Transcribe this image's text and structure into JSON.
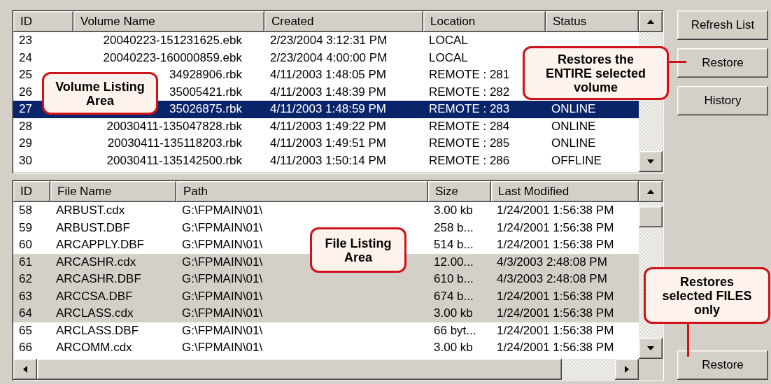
{
  "volumes": {
    "columns": [
      "ID",
      "Volume Name",
      "Created",
      "Location",
      "Status"
    ],
    "rows": [
      {
        "id": "23",
        "name": "20040223-151231625.ebk",
        "created": "2/23/2004 3:12:31 PM",
        "location": "LOCAL",
        "selected": false
      },
      {
        "id": "24",
        "name": "20040223-160000859.ebk",
        "created": "2/23/2004 4:00:00 PM",
        "location": "LOCAL",
        "selected": false
      },
      {
        "id": "25",
        "name": "34928906.rbk",
        "created": "4/11/2003 1:48:05 PM",
        "location": "REMOTE : 281",
        "selected": false
      },
      {
        "id": "26",
        "name": "35005421.rbk",
        "created": "4/11/2003 1:48:39 PM",
        "location": "REMOTE : 282",
        "selected": false
      },
      {
        "id": "27",
        "name": "35026875.rbk",
        "created": "4/11/2003 1:48:59 PM",
        "location": "REMOTE : 283",
        "status": "ONLINE",
        "selected": true
      },
      {
        "id": "28",
        "name": "20030411-135047828.rbk",
        "created": "4/11/2003 1:49:22 PM",
        "location": "REMOTE : 284",
        "status": "ONLINE",
        "selected": false
      },
      {
        "id": "29",
        "name": "20030411-135118203.rbk",
        "created": "4/11/2003 1:49:51 PM",
        "location": "REMOTE : 285",
        "status": "ONLINE",
        "selected": false
      },
      {
        "id": "30",
        "name": "20030411-135142500.rbk",
        "created": "4/11/2003 1:50:14 PM",
        "location": "REMOTE : 286",
        "status": "OFFLINE",
        "selected": false
      }
    ]
  },
  "actions": [
    "Refresh List",
    "Restore",
    "History"
  ],
  "files": {
    "columns": [
      "ID",
      "File Name",
      "Path",
      "Size",
      "Last Modified"
    ],
    "rows": [
      {
        "id": "58",
        "name": "ARBUST.cdx",
        "path": "G:\\FPMAIN\\01\\",
        "size": "3.00 kb",
        "modified": "1/24/2001 1:56:38 PM",
        "selected": false
      },
      {
        "id": "59",
        "name": "ARBUST.DBF",
        "path": "G:\\FPMAIN\\01\\",
        "size": "258 b...",
        "modified": "1/24/2001 1:56:38 PM",
        "selected": false
      },
      {
        "id": "60",
        "name": "ARCAPPLY.DBF",
        "path": "G:\\FPMAIN\\01\\",
        "size": "514 b...",
        "modified": "1/24/2001 1:56:38 PM",
        "selected": false
      },
      {
        "id": "61",
        "name": "ARCASHR.cdx",
        "path": "G:\\FPMAIN\\01\\",
        "size": "12.00...",
        "modified": "4/3/2003 2:48:08 PM",
        "selected": true
      },
      {
        "id": "62",
        "name": "ARCASHR.DBF",
        "path": "G:\\FPMAIN\\01\\",
        "size": "610 b...",
        "modified": "4/3/2003 2:48:08 PM",
        "selected": true
      },
      {
        "id": "63",
        "name": "ARCCSA.DBF",
        "path": "G:\\FPMAIN\\01\\",
        "size": "674 b...",
        "modified": "1/24/2001 1:56:38 PM",
        "selected": true
      },
      {
        "id": "64",
        "name": "ARCLASS.cdx",
        "path": "G:\\FPMAIN\\01\\",
        "size": "3.00 kb",
        "modified": "1/24/2001 1:56:38 PM",
        "selected": true
      },
      {
        "id": "65",
        "name": "ARCLASS.DBF",
        "path": "G:\\FPMAIN\\01\\",
        "size": "66 byt...",
        "modified": "1/24/2001 1:56:38 PM",
        "selected": false
      },
      {
        "id": "66",
        "name": "ARCOMM.cdx",
        "path": "G:\\FPMAIN\\01\\",
        "size": "3.00 kb",
        "modified": "1/24/2001 1:56:38 PM",
        "selected": false
      }
    ]
  },
  "restore_files_button": "Restore",
  "callouts": [
    {
      "kind": "volume-area",
      "text": "Volume Listing\nArea"
    },
    {
      "kind": "restore-volume",
      "text": "Restores the\nENTIRE selected\nvolume"
    },
    {
      "kind": "file-area",
      "text": "File Listing\nArea"
    },
    {
      "kind": "restore-files",
      "text": "Restores\nselected FILES\nonly"
    }
  ]
}
